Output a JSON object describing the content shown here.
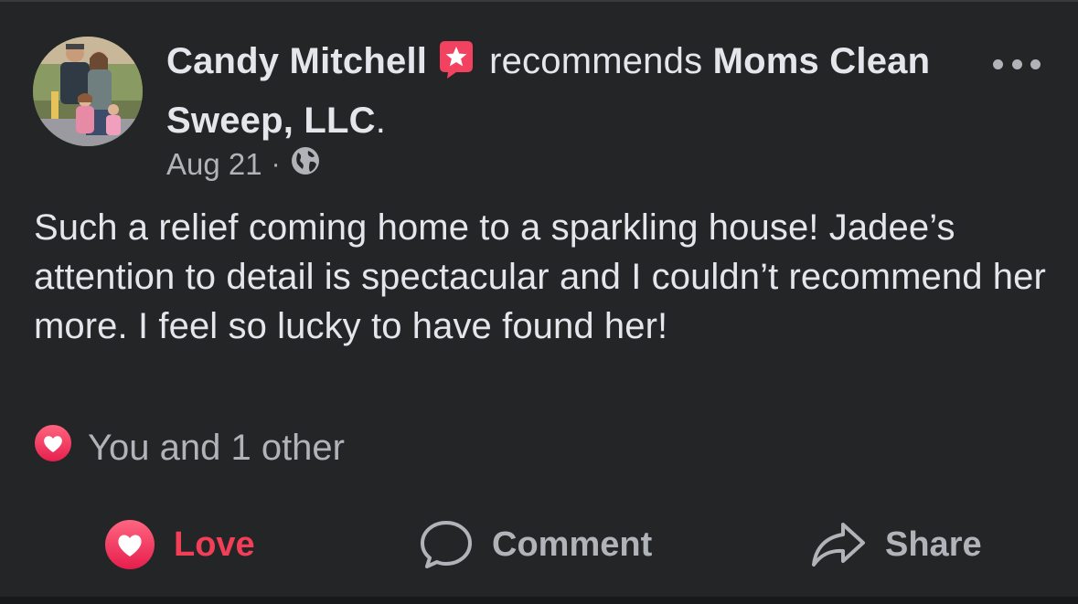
{
  "post": {
    "author": "Candy Mitchell",
    "verb": "recommends",
    "page_name": "Moms Clean Sweep, LLC",
    "period": ".",
    "date": "Aug 21",
    "separator": "·",
    "audience_icon": "globe-icon",
    "badge_icon": "recommendation-star-icon",
    "more_icon": "more-options-icon",
    "text": "Such a relief coming home to a sparkling house! Jadee’s attention to detail is spectacular and I couldn’t recommend her more. I feel so lucky to have found her!"
  },
  "reactions": {
    "icon": "love-reaction-icon",
    "summary": "You and 1 other"
  },
  "actions": {
    "love_label": "Love",
    "comment_label": "Comment",
    "share_label": "Share",
    "love_icon": "heart-icon",
    "comment_icon": "speech-bubble-icon",
    "share_icon": "share-arrow-icon"
  },
  "colors": {
    "background": "#242526",
    "text_primary": "#e4e6eb",
    "text_secondary": "#b0b3b8",
    "love_red": "#f33e58",
    "badge_pink": "#f3425f"
  }
}
